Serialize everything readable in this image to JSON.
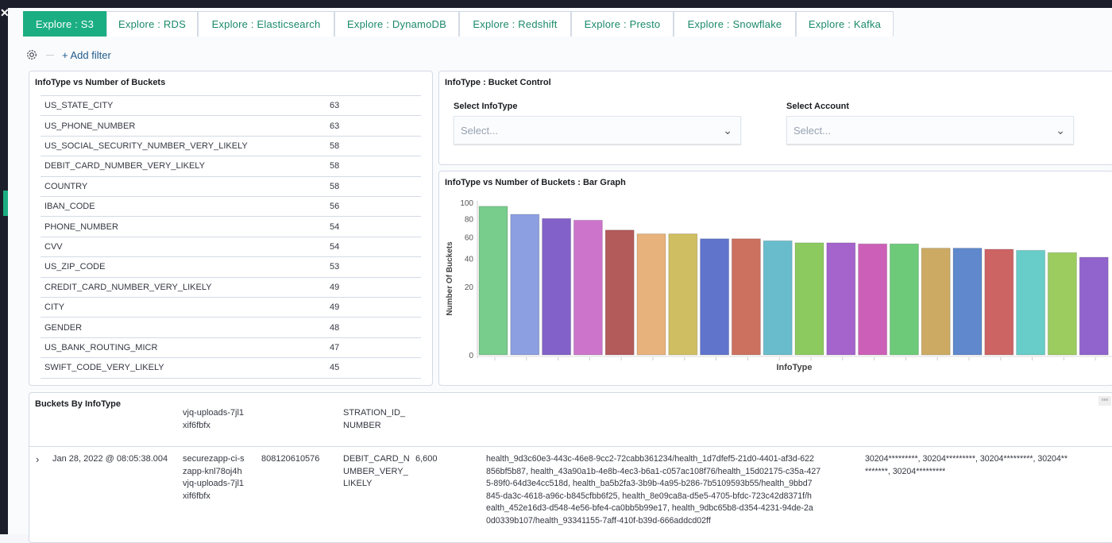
{
  "tabs": [
    "Explore : S3",
    "Explore : RDS",
    "Explore : Elasticsearch",
    "Explore : DynamoDB",
    "Explore : Redshift",
    "Explore : Presto",
    "Explore : Snowflake",
    "Explore : Kafka"
  ],
  "active_tab": 0,
  "filter": {
    "add_label": "+ Add filter"
  },
  "infotype_table": {
    "title": "InfoType vs Number of Buckets",
    "rows": [
      [
        "US_STATE_CITY",
        "63"
      ],
      [
        "US_PHONE_NUMBER",
        "63"
      ],
      [
        "US_SOCIAL_SECURITY_NUMBER_VERY_LIKELY",
        "58"
      ],
      [
        "DEBIT_CARD_NUMBER_VERY_LIKELY",
        "58"
      ],
      [
        "COUNTRY",
        "58"
      ],
      [
        "IBAN_CODE",
        "56"
      ],
      [
        "PHONE_NUMBER",
        "54"
      ],
      [
        "CVV",
        "54"
      ],
      [
        "US_ZIP_CODE",
        "53"
      ],
      [
        "CREDIT_CARD_NUMBER_VERY_LIKELY",
        "49"
      ],
      [
        "CITY",
        "49"
      ],
      [
        "GENDER",
        "48"
      ],
      [
        "US_BANK_ROUTING_MICR",
        "47"
      ],
      [
        "SWIFT_CODE_VERY_LIKELY",
        "45"
      ]
    ]
  },
  "control": {
    "title": "InfoType : Bucket Control",
    "infotype_label": "Select InfoType",
    "infotype_placeholder": "Select...",
    "account_label": "Select Account",
    "account_placeholder": "Select..."
  },
  "chart_data": {
    "type": "bar",
    "title": "InfoType vs Number of Buckets : Bar Graph",
    "xlabel": "InfoType",
    "ylabel": "Number Of Buckets",
    "y_scale": "sqrt",
    "ylim": [
      0,
      100
    ],
    "yticks": [
      0,
      20,
      40,
      60,
      80,
      100
    ],
    "grid": false,
    "values": [
      95,
      85,
      80,
      78,
      67,
      63,
      63,
      58,
      58,
      56,
      54,
      54,
      53,
      53,
      49,
      49,
      48,
      47,
      45,
      41
    ],
    "colors": [
      "#78cc8c",
      "#8c9fe0",
      "#8262c8",
      "#cc74cc",
      "#b35a5a",
      "#e8b27c",
      "#cfbe62",
      "#6074cc",
      "#cc7060",
      "#68bccc",
      "#8cca60",
      "#a464cc",
      "#cc60b8",
      "#6cca78",
      "#ccaa64",
      "#6088cc",
      "#cc6464",
      "#68ccc8",
      "#9ccc60",
      "#9064cc"
    ]
  },
  "buckets": {
    "title": "Buckets By InfoType",
    "partial_row": {
      "bucket": "vjq-uploads-7jl1\nxif6fbfx",
      "infotype": "STRATION_ID_\nNUMBER"
    },
    "row": {
      "time": "Jan 28, 2022 @ 08:05:38.004",
      "bucket": "securezapp-ci-s\nzapp-knl78oj4h\nvjq-uploads-7jl1\nxif6fbfx",
      "account": "808120610576",
      "infotype": "DEBIT_CARD_N\nUMBER_VERY_\nLIKELY",
      "count": "6,600",
      "health": "health_9d3c60e3-443c-46e8-9cc2-72cabb361234/health_1d7dfef5-21d0-4401-af3d-622\n856bf5b87, health_43a90a1b-4e8b-4ec3-b6a1-c057ac108f76/health_15d02175-c35a-427\n5-89f0-64d3e4cc518d, health_ba5b2fa3-3b9b-4a95-b286-7b5109593b55/health_9bbd7\n845-da3c-4618-a96c-b845cfbb6f25, health_8e09ca8a-d5e5-4705-bfdc-723c42d8371f/h\nealth_452e16d3-d548-4e56-bfe4-ca0bb5b99e17, health_9dbc65b8-d354-4231-94de-2a\n0d0339b107/health_93341155-7aff-410f-b39d-666addcd02ff",
      "masked": "30204*********, 30204*********, 30204*********, 30204**\n*******, 30204*********"
    }
  }
}
